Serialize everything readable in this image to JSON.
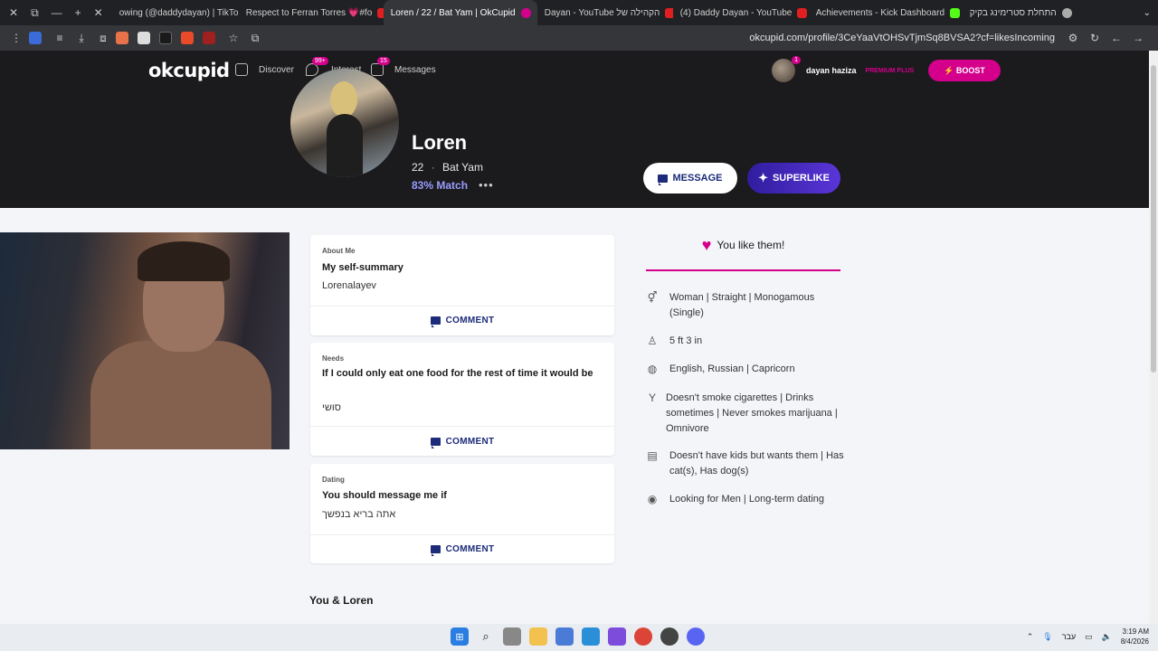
{
  "browser": {
    "tabs": [
      {
        "title": "owing (@daddydayan) | TikTok",
        "active": false,
        "favicon": "tiktok-icon"
      },
      {
        "title": "Respect to Ferran Torres 💗#fo",
        "active": false,
        "favicon": "youtube-icon"
      },
      {
        "title": "Loren / 22 / Bat Yam | OkCupid",
        "active": true,
        "favicon": "okcupid-icon"
      },
      {
        "title": "Dayan - YouTube הקהילה של",
        "active": false,
        "favicon": "youtube-icon"
      },
      {
        "title": "(4) Daddy Dayan - YouTube",
        "active": false,
        "favicon": "youtube-icon"
      },
      {
        "title": "Achievements - Kick Dashboard",
        "active": false,
        "favicon": "kick-icon"
      },
      {
        "title": "התחלת סטרימינג בקיק",
        "active": false,
        "favicon": "globe-icon"
      }
    ],
    "url": "okcupid.com/profile/3CeYaaVtOHSvTjmSq8BVSA2?cf=likesIncoming"
  },
  "header": {
    "logo": "okcupid",
    "nav": [
      {
        "label": "Discover",
        "badge": ""
      },
      {
        "label": "Interest",
        "badge": "99+"
      },
      {
        "label": "Messages",
        "badge": "15"
      }
    ],
    "user": {
      "name": "dayan haziza",
      "tier": "PREMIUM PLUS",
      "badge": "1"
    },
    "boost_label": "⚡ BOOST"
  },
  "profile": {
    "name": "Loren",
    "age": "22",
    "location": "Bat Yam",
    "match": "83% Match",
    "more": "•••",
    "message_label": "MESSAGE",
    "superlike_label": "SUPERLIKE"
  },
  "cards": [
    {
      "category": "About Me",
      "title": "My self-summary",
      "body": "Lorenalayev",
      "comment": "COMMENT"
    },
    {
      "category": "Needs",
      "title": "If I could only eat one food for the rest of time it would be",
      "body": "סושי",
      "comment": "COMMENT"
    },
    {
      "category": "Dating",
      "title": "You should message me if",
      "body": "אתה בריא בנפשך",
      "comment": "COMMENT"
    }
  ],
  "like_status": "You like them!",
  "details": [
    {
      "icon": "gender-icon",
      "text": "Woman | Straight | Monogamous (Single)"
    },
    {
      "icon": "height-icon",
      "text": "5 ft 3 in"
    },
    {
      "icon": "globe-icon",
      "text": "English, Russian | Capricorn"
    },
    {
      "icon": "cocktail-icon",
      "text": "Doesn't smoke cigarettes | Drinks sometimes | Never smokes marijuana | Omnivore"
    },
    {
      "icon": "family-icon",
      "text": "Doesn't have kids but wants them | Has cat(s), Has dog(s)"
    },
    {
      "icon": "eye-icon",
      "text": "Looking for Men | Long-term dating"
    }
  ],
  "section_title": "You & Loren",
  "taskbar": {
    "lang": "עבר",
    "time": "3:19 AM",
    "date": "8/4/2026"
  },
  "colors": {
    "brand_pink": "#d4008c",
    "navy": "#1c2b7a",
    "match_purple": "#9a9cff"
  }
}
